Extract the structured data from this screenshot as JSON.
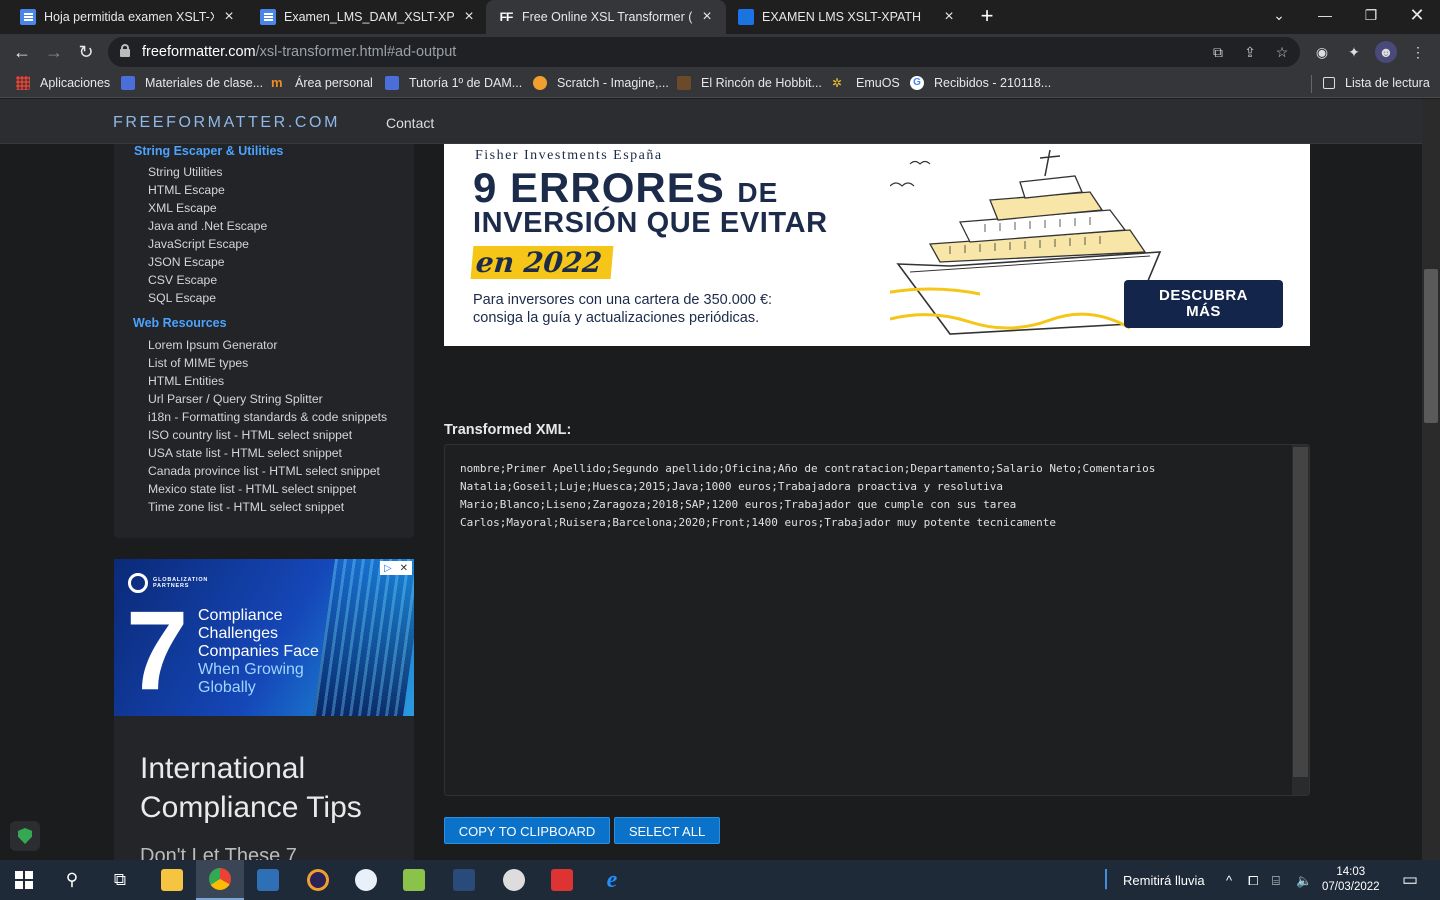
{
  "browser": {
    "tabs": [
      {
        "title": "Hoja permitida examen XSLT-XPath",
        "icon": "docs-icon",
        "active": false
      },
      {
        "title": "Examen_LMS_DAM_XSLT-XPATH",
        "icon": "docs-icon",
        "active": false
      },
      {
        "title": "Free Online XSL Transformer (XSL",
        "icon": "ff-icon",
        "active": true
      },
      {
        "title": "EXAMEN LMS XSLT-XPATH",
        "icon": "classroom-icon",
        "active": false
      }
    ],
    "url_host": "freeformatter.com",
    "url_path": "/xsl-transformer.html#ad-output",
    "bookmarks": [
      "Aplicaciones",
      "Materiales de clase...",
      "Área personal",
      "Tutoría 1º de DAM...",
      "Scratch - Imagine,...",
      "El Rincón de Hobbit...",
      "EmuOS",
      "Recibidos - 210118..."
    ],
    "reading_list": "Lista de lectura"
  },
  "site": {
    "brand": "FREEFORMATTER.COM",
    "nav_contact": "Contact"
  },
  "sidebar": {
    "section1": "String Escaper & Utilities",
    "section1_items": [
      "String Utilities",
      "HTML Escape",
      "XML Escape",
      "Java and .Net Escape",
      "JavaScript Escape",
      "JSON Escape",
      "CSV Escape",
      "SQL Escape"
    ],
    "section2": "Web Resources",
    "section2_items": [
      "Lorem Ipsum Generator",
      "List of MIME types",
      "HTML Entities",
      "Url Parser / Query String Splitter",
      "i18n - Formatting standards & code snippets",
      "ISO country list - HTML select snippet",
      "USA state list - HTML select snippet",
      "Canada province list - HTML select snippet",
      "Mexico state list - HTML select snippet",
      "Time zone list - HTML select snippet"
    ]
  },
  "ad_top": {
    "brand": "Fisher Investments España",
    "line1": "9 ERRORES",
    "line1_de": "DE",
    "line2": "INVERSIÓN QUE EVITAR",
    "year": "en 2022",
    "text1": "Para inversores con una cartera de 350.000 €:",
    "text2": "consiga la guía y actualizaciones periódicas.",
    "cta1": "DESCUBRA",
    "cta2": "MÁS"
  },
  "ad_left": {
    "logo1": "GLOBALIZATION",
    "logo2": "PARTNERS",
    "number": "7",
    "l1": "Compliance",
    "l2": "Challenges",
    "l3": "Companies Face",
    "l4": "When Growing",
    "l5": "Globally",
    "title": "International Compliance Tips",
    "sub": "Don't Let These 7"
  },
  "output": {
    "label": "Transformed XML:",
    "lines": [
      "nombre;Primer Apellido;Segundo apellido;Oficina;Año de contratacion;Departamento;Salario Neto;Comentarios",
      "Natalia;Goseil;Luje;Huesca;2015;Java;1000 euros;Trabajadora proactiva y resolutiva",
      "Mario;Blanco;Liseno;Zaragoza;2018;SAP;1200 euros;Trabajador que cumple con sus tarea",
      "Carlos;Mayoral;Ruisera;Barcelona;2020;Front;1400 euros;Trabajador muy potente tecnicamente"
    ],
    "copy_button": "COPY TO CLIPBOARD",
    "select_button": "SELECT ALL"
  },
  "taskbar": {
    "weather": "Remitirá lluvia",
    "time": "14:03",
    "date": "07/03/2022"
  }
}
